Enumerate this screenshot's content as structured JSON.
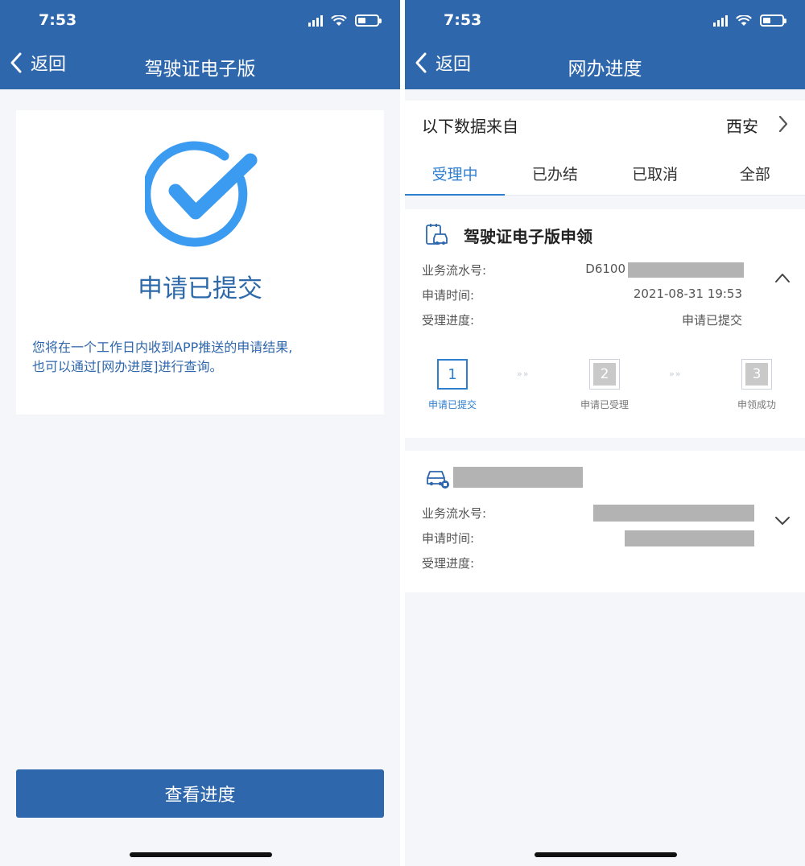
{
  "status_bar": {
    "time": "7:53"
  },
  "left_screen": {
    "nav": {
      "back_label": "返回",
      "title": "驾驶证电子版"
    },
    "result": {
      "title": "申请已提交",
      "description_line1": "您将在一个工作日内收到APP推送的申请结果,",
      "description_line2": "也可以通过[网办进度]进行查询。"
    },
    "button_label": "查看进度",
    "colors": {
      "accent": "#2f67ad",
      "check": "#3a9bf0"
    }
  },
  "right_screen": {
    "nav": {
      "back_label": "返回",
      "title": "网办进度"
    },
    "source": {
      "label": "以下数据来自",
      "city": "西安"
    },
    "tabs": [
      {
        "label": "受理中",
        "active": true
      },
      {
        "label": "已办结",
        "active": false
      },
      {
        "label": "已取消",
        "active": false
      },
      {
        "label": "全部",
        "active": false
      }
    ],
    "card1": {
      "title": "驾驶证电子版申领",
      "icon": "document-car-icon",
      "rows": [
        {
          "label": "业务流水号:",
          "value": "D6100"
        },
        {
          "label": "申请时间:",
          "value": "2021-08-31 19:53"
        },
        {
          "label": "受理进度:",
          "value": "申请已提交"
        }
      ],
      "steps": [
        {
          "number": "1",
          "label": "申请已提交",
          "active": true
        },
        {
          "number": "2",
          "label": "申请已受理",
          "active": false
        },
        {
          "number": "3",
          "label": "申领成功",
          "active": false
        }
      ],
      "step_arrow": "»»",
      "expanded": true
    },
    "card2": {
      "icon": "car-icon",
      "rows": [
        {
          "label": "业务流水号:"
        },
        {
          "label": "申请时间:"
        },
        {
          "label": "受理进度:"
        }
      ],
      "expanded": false
    }
  }
}
